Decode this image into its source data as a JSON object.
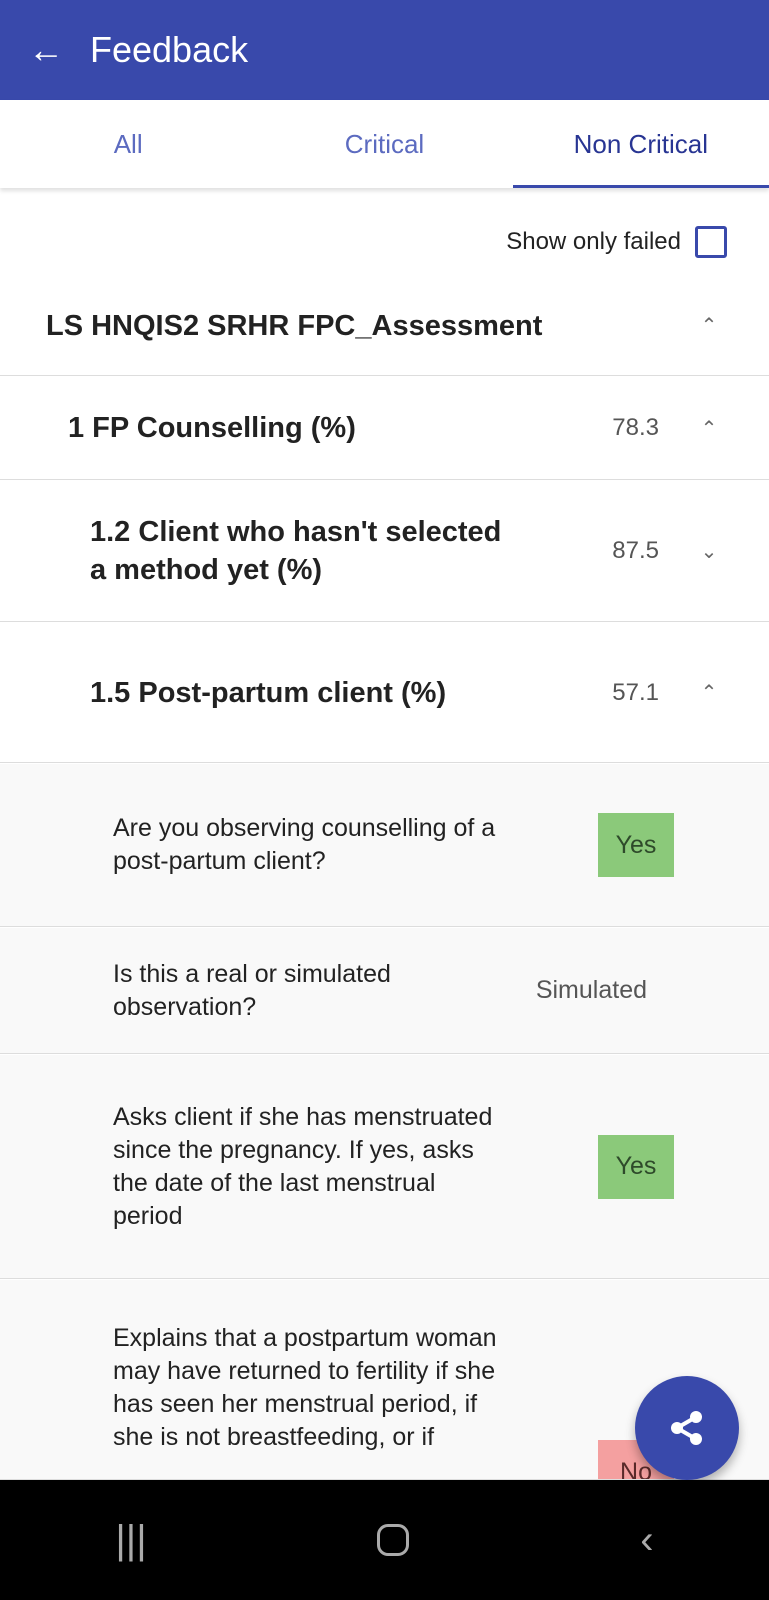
{
  "appbar": {
    "title": "Feedback",
    "back_icon": "arrow-left-icon"
  },
  "tabs": [
    {
      "label": "All"
    },
    {
      "label": "Critical"
    },
    {
      "label": "Non Critical",
      "active": true
    }
  ],
  "filter": {
    "label": "Show only failed",
    "checked": false
  },
  "assessment": {
    "title": "LS HNQIS2 SRHR FPC_Assessment"
  },
  "sections": [
    {
      "label": "1 FP Counselling (%)",
      "score": "78.3",
      "expanded": true
    },
    {
      "label": "1.2 Client who hasn't selected a method yet (%)",
      "score": "87.5",
      "expanded": false
    },
    {
      "label": "1.5 Post-partum client (%)",
      "score": "57.1",
      "expanded": true
    }
  ],
  "questions": [
    {
      "text": "Are you observing counselling of a post-partum client?",
      "answer": "Yes"
    },
    {
      "text": "Is this a real or simulated observation?",
      "answer": "Simulated"
    },
    {
      "text": "Asks client if she has menstruated since the pregnancy. If yes, asks the date of the last menstrual period",
      "answer": "Yes"
    },
    {
      "text": "Explains that a postpartum woman may have returned to fertility if she has seen her menstrual period, if she is not breastfeeding, or if",
      "answer": "No"
    }
  ],
  "colors": {
    "primary": "#3949ab",
    "yes": "#8bc97a",
    "no": "#f4a0a0"
  }
}
